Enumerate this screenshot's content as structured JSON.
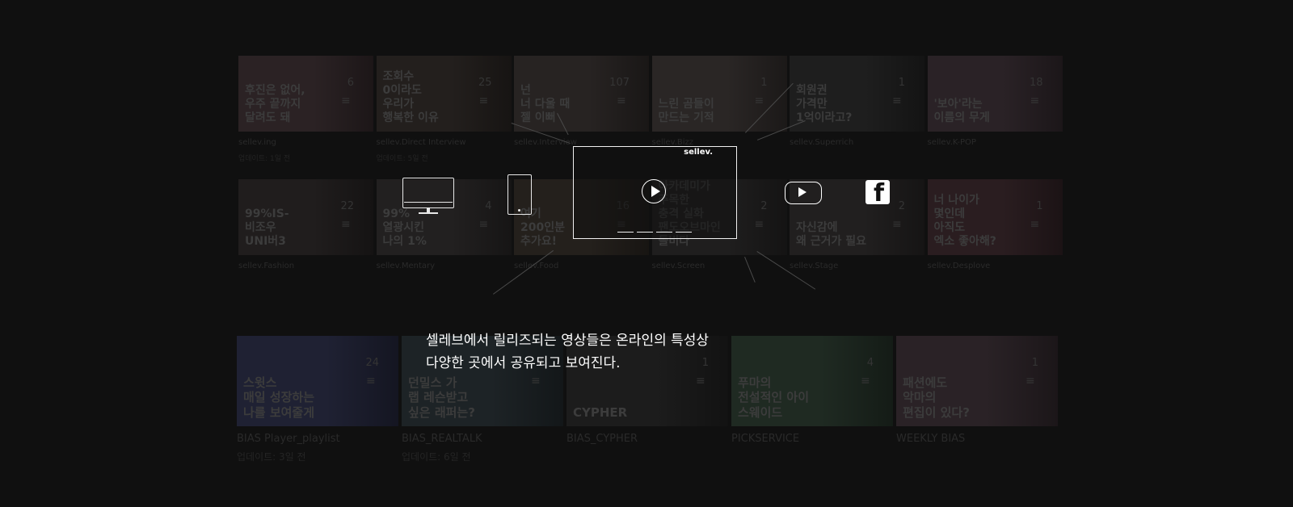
{
  "row1": [
    {
      "thumb": "후진은 없어,\n우주 끝까지\n달려도 돼",
      "count": "6",
      "title": "sellev.ing",
      "meta": "업데이트: 1일 전",
      "tone": "#2b2224"
    },
    {
      "thumb": "조회수\n0이라도\n우리가\n행복한 이유",
      "count": "25",
      "title": "sellev.Direct Interview",
      "meta": "업데이트: 5일 전",
      "tone": "#231f1d"
    },
    {
      "thumb": "넌\n너 다울 때\n젤 이뻐",
      "count": "107",
      "title": "sellev.Interview",
      "meta": "",
      "tone": "#272322"
    },
    {
      "thumb": "느린 곰들이\n만드는 기적",
      "count": "1",
      "title": "sellev.Bizz",
      "meta": "",
      "tone": "#2a2625"
    },
    {
      "thumb": "회원권\n가격만\n1억이라고?",
      "count": "1",
      "title": "sellev.Superrich",
      "meta": "",
      "tone": "#1e1e1e"
    },
    {
      "thumb": "'보아'라는\n이름의 무게",
      "count": "18",
      "title": "sellev.K-POP",
      "meta": "",
      "tone": "#2a2226"
    }
  ],
  "row2": [
    {
      "thumb": "99%IS-\n비조우\nUNI버3",
      "count": "22",
      "title": "sellev.Fashion",
      "meta": "",
      "tone": "#201d1d"
    },
    {
      "thumb": "99%\n열광시킨\n나의 1%",
      "count": "4",
      "title": "sellev.Mentary",
      "meta": "",
      "tone": "#222020"
    },
    {
      "thumb": "여기\n200인분\n추가요!",
      "count": "16",
      "title": "sellev.Food",
      "meta": "",
      "tone": "#24201c"
    },
    {
      "thumb": "아카데미가\n주목한\n충격 실화\n팬도오브마인\n돌비다",
      "count": "2",
      "title": "sellev.Screen",
      "meta": "",
      "tone": "#1f1e1e"
    },
    {
      "thumb": "자신감에\n왜 근거가 필요",
      "count": "2",
      "title": "sellev.Stage",
      "meta": "",
      "tone": "#211f1f"
    },
    {
      "thumb": "너 나이가\n몇인데\n아직도\n엑소 좋아해?",
      "count": "1",
      "title": "sellev.Desplove",
      "meta": "",
      "tone": "#2a1d20"
    }
  ],
  "row3": [
    {
      "thumb": "스윗스\n매일 성장하는\n나를 보여줄게",
      "count": "24",
      "title": "BIAS Player_playlist",
      "meta": "업데이트: 3일 전",
      "tone": "#1f2133"
    },
    {
      "thumb": "던밀스 가\n랩 레슨받고\n싶은 래퍼는?",
      "count": "4",
      "title": "BIAS_REALTALK",
      "meta": "업데이트: 6일 전",
      "tone": "#1d2326"
    },
    {
      "thumb": "CYPHER",
      "count": "1",
      "title": "BIAS_CYPHER",
      "meta": "",
      "tone": "#1c1c1c"
    },
    {
      "thumb": "푸마의\n전설적인 아이\n스웨이드",
      "count": "4",
      "title": "PICKSERVICE",
      "meta": "",
      "tone": "#1f2a22"
    },
    {
      "thumb": "패션에도\n악마의\n편집이 있다?",
      "count": "1",
      "title": "WEEKLY BIAS",
      "meta": "",
      "tone": "#2a2226"
    }
  ],
  "player": {
    "logo": "sellev."
  },
  "caption": {
    "line1": "셀레브에서 릴리즈되는 영상들은 온라인의 특성상",
    "line2": "다양한 곳에서 공유되고 보여진다."
  },
  "icons": {
    "monitor": "monitor-icon",
    "phone": "phone-icon",
    "player": "video-player-icon",
    "youtube": "youtube-icon",
    "facebook": "facebook-icon",
    "facebook_glyph": "f"
  },
  "colors": {
    "background": "#101010",
    "overlay_stroke": "#ffffff",
    "dim_text": "#2a2a2a"
  }
}
